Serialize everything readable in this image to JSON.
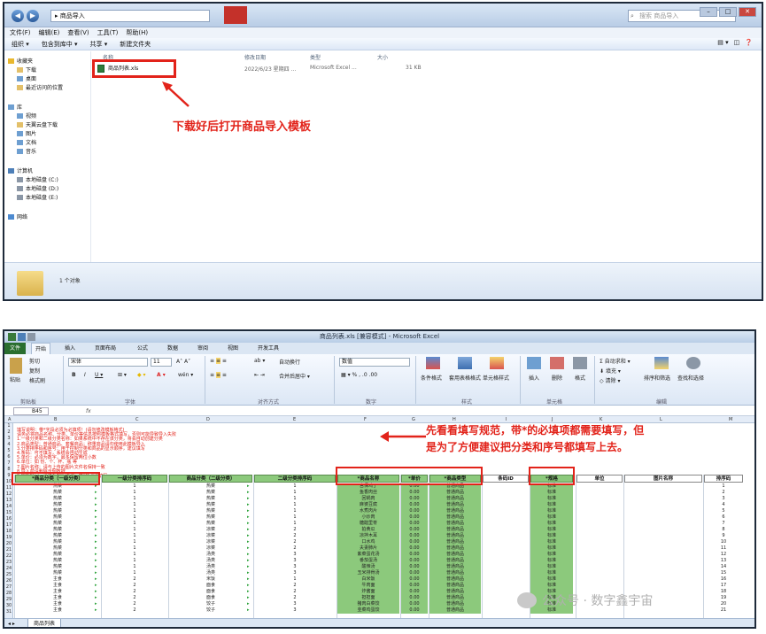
{
  "explorer": {
    "address": "▸ 商品导入",
    "search_placeholder": "搜索 商品导入",
    "menu": [
      "文件(F)",
      "编辑(E)",
      "查看(V)",
      "工具(T)",
      "帮助(H)"
    ],
    "toolbar": [
      "组织 ▾",
      "包含到库中 ▾",
      "共享 ▾",
      "新建文件夹"
    ],
    "nav": {
      "favorites": "收藏夹",
      "fav_items": [
        "下载",
        "桌面",
        "最近访问的位置"
      ],
      "library": "库",
      "lib_items": [
        "视频",
        "天翼云盘下载",
        "图片",
        "文档",
        "音乐"
      ],
      "computer": "计算机",
      "drives": [
        "本地磁盘 (C:)",
        "本地磁盘 (D:)",
        "本地磁盘 (E:)"
      ],
      "network": "网络"
    },
    "columns": [
      "名称",
      "修改日期",
      "类型",
      "大小"
    ],
    "file": {
      "name": "商品列表.xls",
      "date": "2022/6/23 星期四 ...",
      "type": "Microsoft Excel ...",
      "size": "31 KB"
    },
    "status_count": "1 个对象",
    "annotation": "下载好后打开商品导入模板"
  },
  "excel": {
    "title": "商品列表.xls [兼容模式] - Microsoft Excel",
    "tabs": [
      "文件",
      "开始",
      "插入",
      "页面布局",
      "公式",
      "数据",
      "审阅",
      "视图",
      "开发工具"
    ],
    "ribbon": {
      "clipboard": {
        "label": "剪贴板",
        "paste": "粘贴",
        "cut": "剪切",
        "copy": "复制",
        "format_painter": "格式刷"
      },
      "font": {
        "label": "字体",
        "name": "宋体",
        "size": "11"
      },
      "alignment": {
        "label": "对齐方式",
        "wrap": "自动换行",
        "merge": "合并后居中 ▾"
      },
      "number": {
        "label": "数字",
        "format": "数值"
      },
      "styles": {
        "label": "样式",
        "conditional": "条件格式",
        "table": "套用表格格式",
        "cell_style": "单元格样式"
      },
      "cells": {
        "label": "单元格",
        "insert": "插入",
        "delete": "删除",
        "format": "格式"
      },
      "editing": {
        "label": "编辑",
        "autosum": "自动求和",
        "fill": "填充",
        "clear": "清除",
        "sort": "排序和筛选",
        "find": "查找和选择"
      }
    },
    "namebox": "B45",
    "columns": [
      "A",
      "B",
      "C",
      "D",
      "E",
      "F",
      "G",
      "H",
      "I",
      "J",
      "K",
      "L",
      "M"
    ],
    "notes": [
      "填写说明：带*字段必须为必填项！(请勿修改模板格式)",
      "请务必将商品名称、分类、单价等信息按照模板格式填写，否则可能导致导入失败",
      "1.一级分类和二级分类名称：如果系统中不存在该分类，将会自动创建分类",
      "2.商品类型：普通商品、套餐商品；称重商品请勿使用此模板导入",
      "3.分类排序码和序号：用于控制分类和商品的显示顺序，建议填写",
      "4.条码：可不填写，系统会自动生成",
      "5.单价：必须为数字，最多保留两位小数",
      "6.单位：如 份、个、杯、瓶 等",
      "7.图片名称：请与上传的图片文件名保持一致",
      "8.导入前请删除示例数据",
      "9.如有疑问，请联系客服咨询：带*项必须填写"
    ],
    "headers": [
      "*商品分类（一级分类）",
      "一级分类排序码",
      "商品分类（二级分类）",
      "二级分类排序码",
      "*商品名称",
      "*单价",
      "*商品类型",
      "条码ID",
      "*规格",
      "单位",
      "图片名称",
      "排序码"
    ],
    "rows": [
      [
        "热菜",
        "1",
        "热菜",
        "1",
        "宫保鸡丁",
        "0.00",
        "普通商品",
        "",
        "标准",
        "",
        "",
        "1"
      ],
      [
        "热菜",
        "1",
        "热菜",
        "1",
        "鱼香肉丝",
        "0.00",
        "普通商品",
        "",
        "标准",
        "",
        "",
        "2"
      ],
      [
        "热菜",
        "1",
        "热菜",
        "1",
        "回锅肉",
        "0.00",
        "普通商品",
        "",
        "标准",
        "",
        "",
        "3"
      ],
      [
        "热菜",
        "1",
        "热菜",
        "1",
        "麻婆豆腐",
        "0.00",
        "普通商品",
        "",
        "标准",
        "",
        "",
        "4"
      ],
      [
        "热菜",
        "1",
        "热菜",
        "1",
        "水煮肉片",
        "0.00",
        "普通商品",
        "",
        "标准",
        "",
        "",
        "5"
      ],
      [
        "热菜",
        "1",
        "热菜",
        "1",
        "小炒肉",
        "0.00",
        "普通商品",
        "",
        "标准",
        "",
        "",
        "6"
      ],
      [
        "热菜",
        "1",
        "热菜",
        "1",
        "糖醋里脊",
        "0.00",
        "普通商品",
        "",
        "标准",
        "",
        "",
        "7"
      ],
      [
        "热菜",
        "1",
        "凉菜",
        "2",
        "拍黄瓜",
        "0.00",
        "普通商品",
        "",
        "标准",
        "",
        "",
        "8"
      ],
      [
        "热菜",
        "1",
        "凉菜",
        "2",
        "凉拌木耳",
        "0.00",
        "普通商品",
        "",
        "标准",
        "",
        "",
        "9"
      ],
      [
        "热菜",
        "1",
        "凉菜",
        "2",
        "口水鸡",
        "0.00",
        "普通商品",
        "",
        "标准",
        "",
        "",
        "10"
      ],
      [
        "热菜",
        "1",
        "凉菜",
        "2",
        "夫妻肺片",
        "0.00",
        "普通商品",
        "",
        "标准",
        "",
        "",
        "11"
      ],
      [
        "热菜",
        "1",
        "汤类",
        "3",
        "紫菜蛋花汤",
        "0.00",
        "普通商品",
        "",
        "标准",
        "",
        "",
        "12"
      ],
      [
        "热菜",
        "1",
        "汤类",
        "3",
        "番茄蛋汤",
        "0.00",
        "普通商品",
        "",
        "标准",
        "",
        "",
        "13"
      ],
      [
        "热菜",
        "1",
        "汤类",
        "3",
        "酸辣汤",
        "0.00",
        "普通商品",
        "",
        "标准",
        "",
        "",
        "14"
      ],
      [
        "热菜",
        "1",
        "汤类",
        "3",
        "玉米排骨汤",
        "0.00",
        "普通商品",
        "",
        "标准",
        "",
        "",
        "15"
      ],
      [
        "主食",
        "2",
        "米饭",
        "1",
        "白米饭",
        "0.00",
        "普通商品",
        "",
        "标准",
        "",
        "",
        "16"
      ],
      [
        "主食",
        "2",
        "面食",
        "2",
        "牛肉面",
        "0.00",
        "普通商品",
        "",
        "标准",
        "",
        "",
        "17"
      ],
      [
        "主食",
        "2",
        "面食",
        "2",
        "炸酱面",
        "0.00",
        "普通商品",
        "",
        "标准",
        "",
        "",
        "18"
      ],
      [
        "主食",
        "2",
        "面食",
        "2",
        "担担面",
        "0.00",
        "普通商品",
        "",
        "标准",
        "",
        "",
        "19"
      ],
      [
        "主食",
        "2",
        "饺子",
        "3",
        "猪肉白菜饺",
        "0.00",
        "普通商品",
        "",
        "标准",
        "",
        "",
        "20"
      ],
      [
        "主食",
        "2",
        "饺子",
        "3",
        "韭菜鸡蛋饺",
        "0.00",
        "普通商品",
        "",
        "标准",
        "",
        "",
        "21"
      ]
    ],
    "annotation_line1": "先看看填写规范，带*的必填项都需要填写，但",
    "annotation_line2": "是为了方便建议把分类和序号都填写上去。",
    "sheet_tab": "商品列表"
  },
  "watermark": "公众号 · 数字鑫宇宙",
  "colors": {
    "red": "#e2231a",
    "header_green": "#8cc97c",
    "excel_green": "#2a6e2f"
  }
}
